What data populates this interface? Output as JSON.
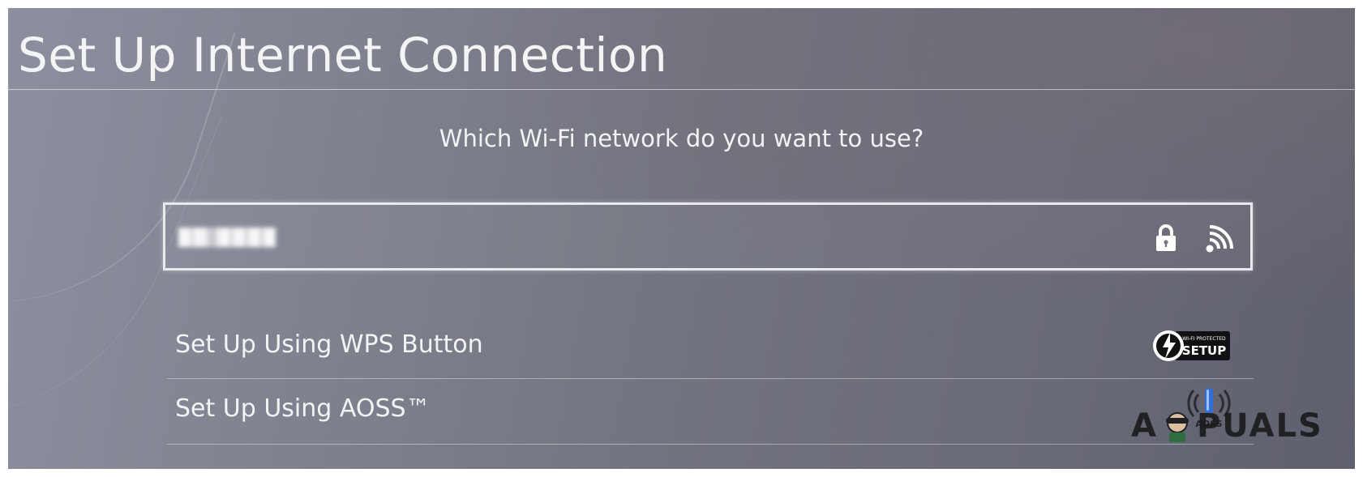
{
  "header": {
    "title": "Set Up Internet Connection"
  },
  "main": {
    "prompt": "Which Wi-Fi network do you want to use?",
    "networks": [
      {
        "ssid": "██ █████",
        "secured": true,
        "icons": [
          "lock-icon",
          "wifi-signal-icon"
        ]
      }
    ],
    "options": [
      {
        "label": "Set Up Using WPS Button",
        "icon": "wps-logo-icon",
        "badge_small": "WI-FI PROTECTED",
        "badge_big": "SETUP"
      },
      {
        "label": "Set Up Using AOSS™",
        "icon": "aoss-logo-icon",
        "badge_text": "AOSS"
      }
    ]
  },
  "watermark": {
    "text_left": "A",
    "text_right": "PUALS"
  }
}
